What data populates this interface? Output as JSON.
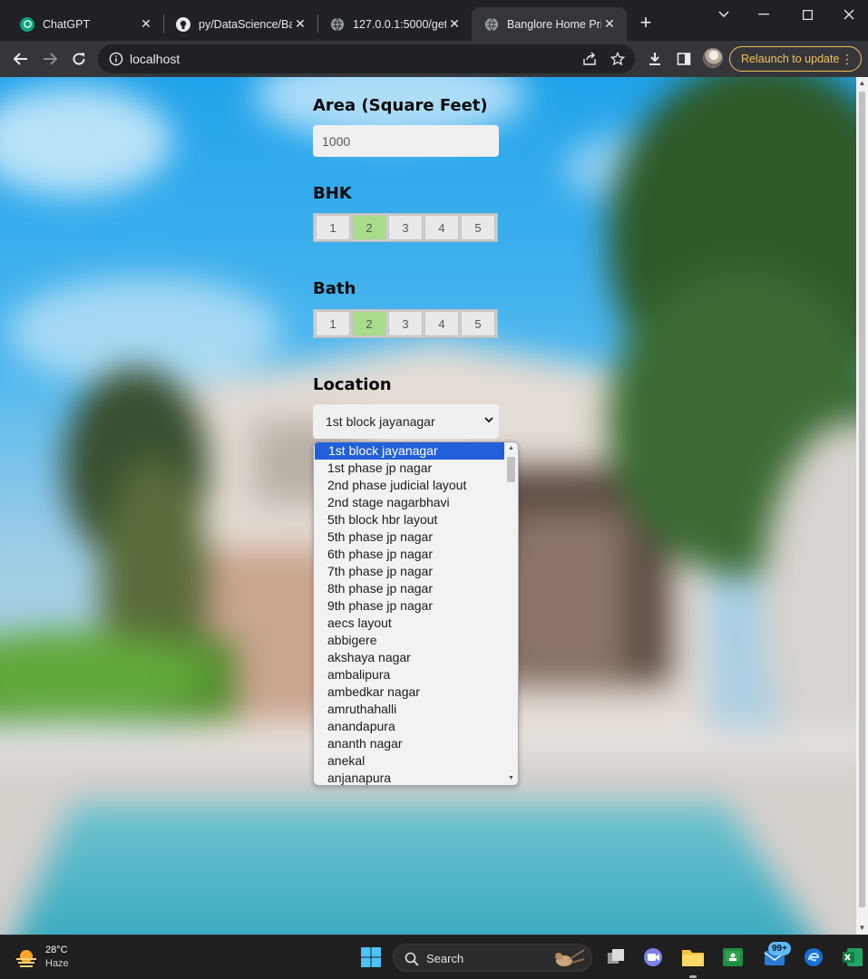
{
  "browser": {
    "tabs": [
      {
        "title": "ChatGPT",
        "icon": "chatgpt-icon"
      },
      {
        "title": "py/DataScience/Ban",
        "icon": "github-icon"
      },
      {
        "title": "127.0.0.1:5000/get_",
        "icon": "globe-icon"
      },
      {
        "title": "Banglore Home Pri",
        "icon": "globe-icon",
        "active": true
      }
    ],
    "url": "localhost",
    "relaunch_label": "Relaunch to update",
    "accent": "#f3c25a"
  },
  "form": {
    "area_label": "Area (Square Feet)",
    "area_value": "1000",
    "bhk_label": "BHK",
    "bhk_options": [
      "1",
      "2",
      "3",
      "4",
      "5"
    ],
    "bhk_selected": "2",
    "bath_label": "Bath",
    "bath_options": [
      "1",
      "2",
      "3",
      "4",
      "5"
    ],
    "bath_selected": "2",
    "location_label": "Location",
    "location_selected": "1st block jayanagar",
    "location_options": [
      "1st block jayanagar",
      "1st phase jp nagar",
      "2nd phase judicial layout",
      "2nd stage nagarbhavi",
      "5th block hbr layout",
      "5th phase jp nagar",
      "6th phase jp nagar",
      "7th phase jp nagar",
      "8th phase jp nagar",
      "9th phase jp nagar",
      "aecs layout",
      "abbigere",
      "akshaya nagar",
      "ambalipura",
      "ambedkar nagar",
      "amruthahalli",
      "anandapura",
      "ananth nagar",
      "anekal",
      "anjanapura"
    ],
    "selected_color": "#a8dc8a",
    "highlight_color": "#2260d9"
  },
  "taskbar": {
    "temperature": "28°C",
    "condition": "Haze",
    "search_label": "Search",
    "mail_badge": "99+"
  }
}
